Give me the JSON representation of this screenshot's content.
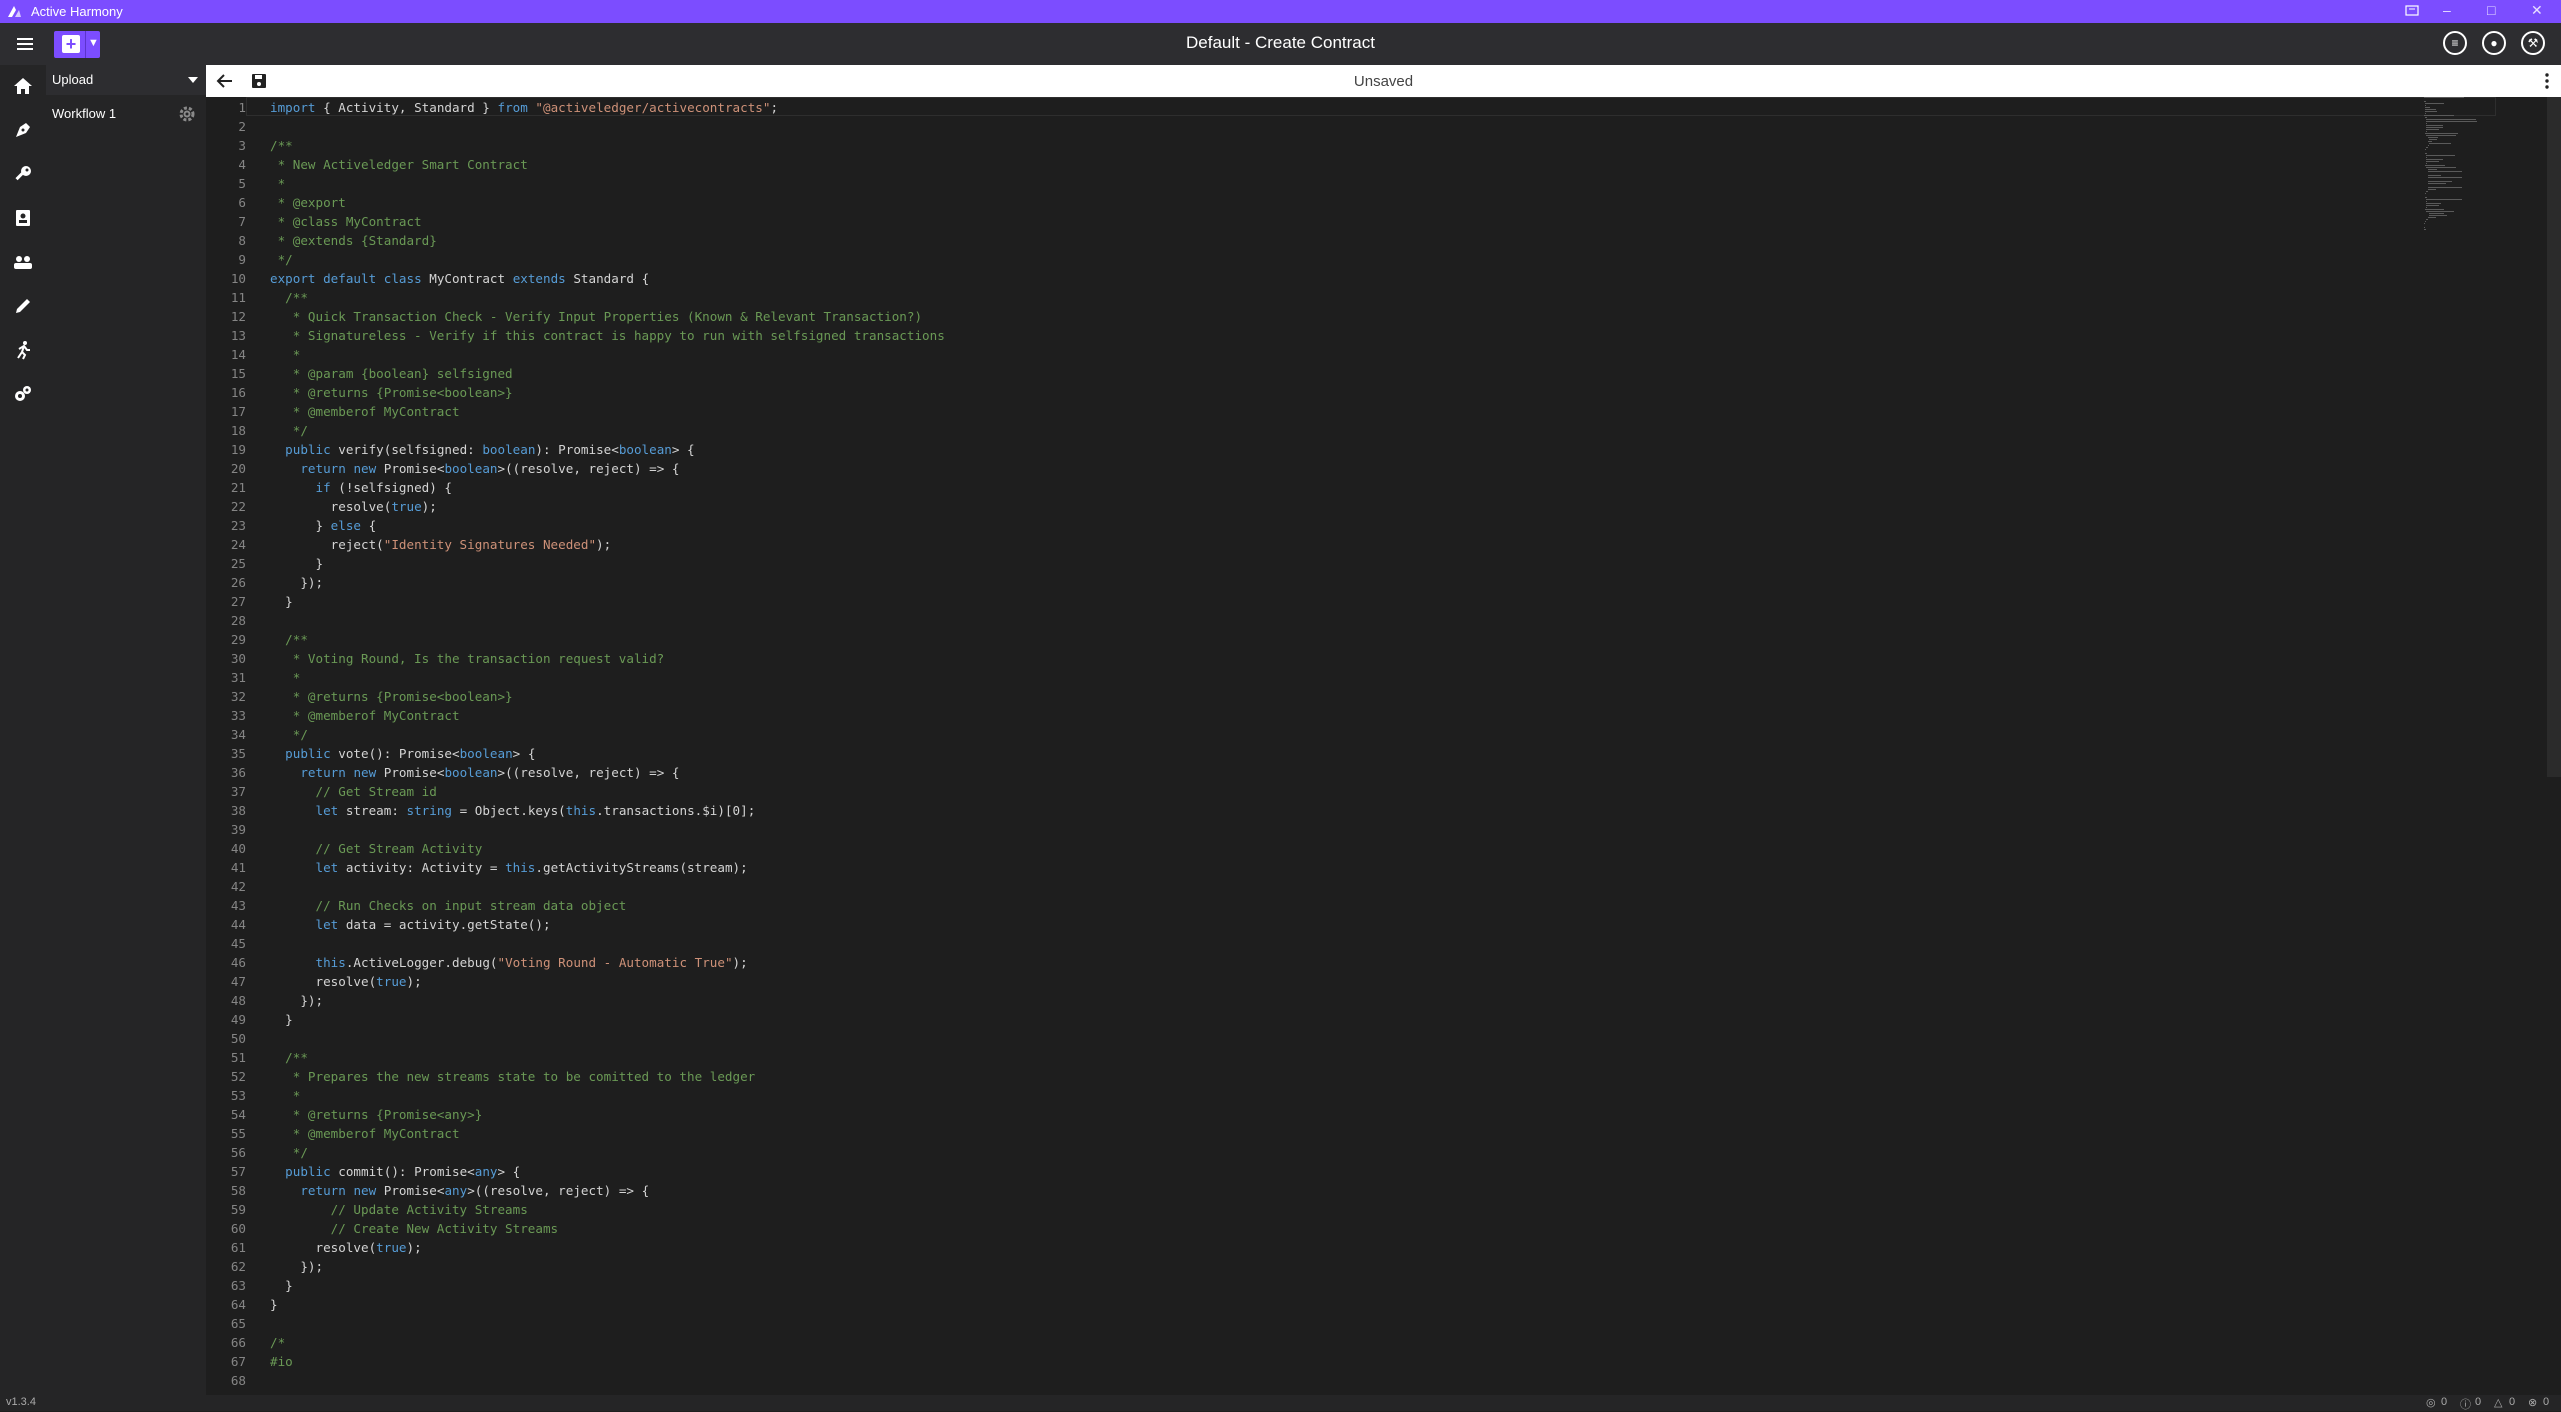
{
  "app": {
    "title": "Active Harmony"
  },
  "header": {
    "document_title": "Default - Create Contract",
    "new_button_label": "+",
    "icons": [
      "server-icon",
      "user-icon",
      "wrench-icon"
    ]
  },
  "rail": {
    "icons": [
      "home-icon",
      "pen-nib-icon",
      "key-icon",
      "address-book-icon",
      "group-icon",
      "pencil-icon",
      "run-icon",
      "settings-cogs-icon"
    ]
  },
  "workflow_panel": {
    "upload_label": "Upload",
    "items": [
      {
        "label": "Workflow 1"
      }
    ]
  },
  "editor": {
    "status": "Unsaved",
    "lines": [
      "import { Activity, Standard } from \"@activeledger/activecontracts\";",
      "",
      "/**",
      " * New Activeledger Smart Contract",
      " *",
      " * @export",
      " * @class MyContract",
      " * @extends {Standard}",
      " */",
      "export default class MyContract extends Standard {",
      "  /**",
      "   * Quick Transaction Check - Verify Input Properties (Known & Relevant Transaction?)",
      "   * Signatureless - Verify if this contract is happy to run with selfsigned transactions",
      "   *",
      "   * @param {boolean} selfsigned",
      "   * @returns {Promise<boolean>}",
      "   * @memberof MyContract",
      "   */",
      "  public verify(selfsigned: boolean): Promise<boolean> {",
      "    return new Promise<boolean>((resolve, reject) => {",
      "      if (!selfsigned) {",
      "        resolve(true);",
      "      } else {",
      "        reject(\"Identity Signatures Needed\");",
      "      }",
      "    });",
      "  }",
      "",
      "  /**",
      "   * Voting Round, Is the transaction request valid?",
      "   *",
      "   * @returns {Promise<boolean>}",
      "   * @memberof MyContract",
      "   */",
      "  public vote(): Promise<boolean> {",
      "    return new Promise<boolean>((resolve, reject) => {",
      "      // Get Stream id",
      "      let stream: string = Object.keys(this.transactions.$i)[0];",
      "",
      "      // Get Stream Activity",
      "      let activity: Activity = this.getActivityStreams(stream);",
      "",
      "      // Run Checks on input stream data object",
      "      let data = activity.getState();",
      "",
      "      this.ActiveLogger.debug(\"Voting Round - Automatic True\");",
      "      resolve(true);",
      "    });",
      "  }",
      "",
      "  /**",
      "   * Prepares the new streams state to be comitted to the ledger",
      "   *",
      "   * @returns {Promise<any>}",
      "   * @memberof MyContract",
      "   */",
      "  public commit(): Promise<any> {",
      "    return new Promise<any>((resolve, reject) => {",
      "        // Update Activity Streams",
      "        // Create New Activity Streams",
      "      resolve(true);",
      "    });",
      "  }",
      "}",
      "",
      "/*",
      "#io",
      ""
    ]
  },
  "statusbar": {
    "version": "v1.3.4",
    "counts": [
      {
        "icon": "globe-icon",
        "value": "0"
      },
      {
        "icon": "info-icon",
        "value": "0"
      },
      {
        "icon": "warning-icon",
        "value": "0"
      },
      {
        "icon": "error-icon",
        "value": "0"
      }
    ]
  },
  "colors": {
    "accent": "#7c4dff",
    "keyword": "#569cd6",
    "string": "#ce9178",
    "comment": "#6a9955"
  }
}
